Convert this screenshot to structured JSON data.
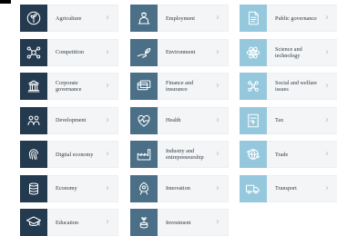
{
  "corner_mark": true,
  "chevron": "›",
  "colors": {
    "dark": "#243a4f",
    "mid": "#4b6f86",
    "light": "#95c8dc",
    "tile_bg": "#f4f5f6",
    "text": "#2f3a44"
  },
  "columns": [
    {
      "items": [
        {
          "label": "Agriculture",
          "icon": "plant-icon",
          "tone": "dark"
        },
        {
          "label": "Competition",
          "icon": "network-icon",
          "tone": "dark"
        },
        {
          "label": "Corporate\ngovernance",
          "icon": "building-icon",
          "tone": "dark"
        },
        {
          "label": "Development",
          "icon": "people-icon",
          "tone": "dark"
        },
        {
          "label": "Digital economy",
          "icon": "fingerprint-icon",
          "tone": "dark"
        },
        {
          "label": "Economy",
          "icon": "coins-icon",
          "tone": "dark"
        },
        {
          "label": "Education",
          "icon": "graduation-cap-icon",
          "tone": "dark"
        }
      ]
    },
    {
      "items": [
        {
          "label": "Employment",
          "icon": "worker-icon",
          "tone": "mid"
        },
        {
          "label": "Environment",
          "icon": "hand-leaf-icon",
          "tone": "mid"
        },
        {
          "label": "Finance and\ninsurance",
          "icon": "cards-icon",
          "tone": "mid"
        },
        {
          "label": "Health",
          "icon": "heartbeat-icon",
          "tone": "mid"
        },
        {
          "label": "Industry and\nentrepreneurship",
          "icon": "factory-icon",
          "tone": "mid"
        },
        {
          "label": "Innovation",
          "icon": "rocket-icon",
          "tone": "mid"
        },
        {
          "label": "Investment",
          "icon": "sprout-coins-icon",
          "tone": "mid"
        }
      ]
    },
    {
      "items": [
        {
          "label": "Public governance",
          "icon": "document-icon",
          "tone": "light"
        },
        {
          "label": "Science and\ntechnology",
          "icon": "atom-icon",
          "tone": "light"
        },
        {
          "label": "Social and welfare\nissues",
          "icon": "community-icon",
          "tone": "light"
        },
        {
          "label": "Tax",
          "icon": "tax-document-icon",
          "tone": "light"
        },
        {
          "label": "Trade",
          "icon": "trade-icon",
          "tone": "light"
        },
        {
          "label": "Transport",
          "icon": "truck-icon",
          "tone": "light"
        }
      ]
    }
  ]
}
